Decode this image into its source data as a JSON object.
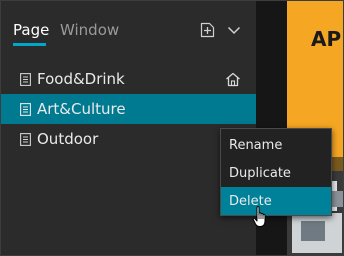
{
  "tabs": {
    "page_label": "Page",
    "window_label": "Window"
  },
  "toolbar": {
    "add_icon": "add-square-icon",
    "more_icon": "chevron-down-icon"
  },
  "pages": [
    {
      "label": "Food&Drink",
      "is_home": true,
      "selected": false
    },
    {
      "label": "Art&Culture",
      "is_home": false,
      "selected": true
    },
    {
      "label": "Outdoor",
      "is_home": false,
      "selected": false
    }
  ],
  "context_menu": {
    "items": [
      {
        "label": "Rename"
      },
      {
        "label": "Duplicate"
      },
      {
        "label": "Delete",
        "hovered": true
      }
    ]
  },
  "canvas": {
    "title_fragment": "AP"
  },
  "colors": {
    "panel_bg": "#2b2b2b",
    "accent": "#00a7c6",
    "selected_row": "#007a91",
    "menu_hover": "#00819a",
    "canvas_orange": "#f5a623"
  }
}
